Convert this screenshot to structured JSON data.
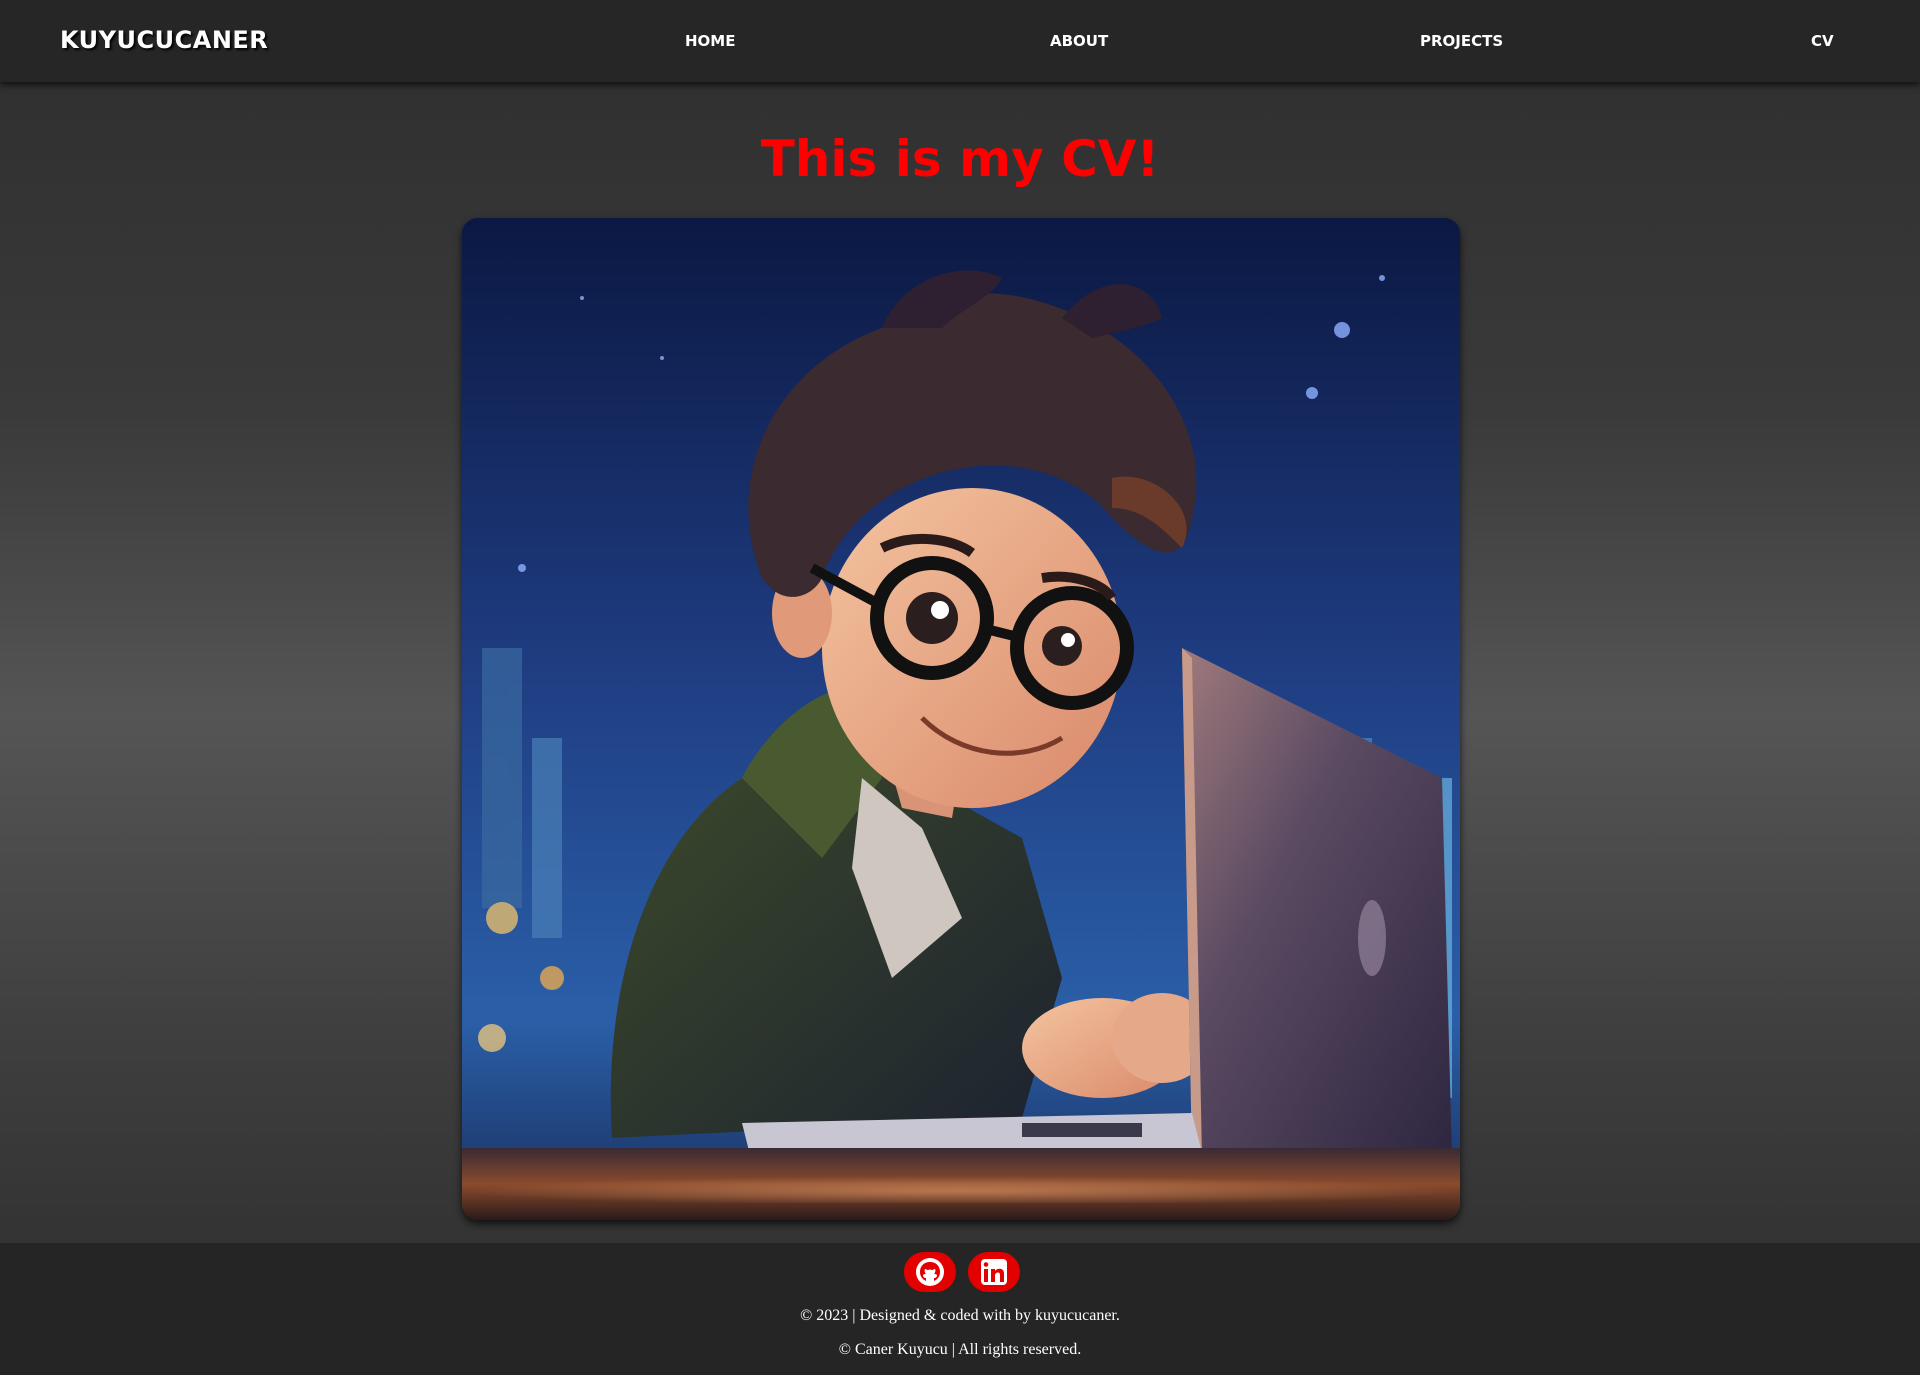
{
  "brand": {
    "name": "KUYUCUCANER"
  },
  "nav": {
    "items": [
      {
        "label": "HOME"
      },
      {
        "label": "ABOUT"
      },
      {
        "label": "PROJECTS"
      },
      {
        "label": "CV"
      }
    ]
  },
  "main": {
    "title": "This is my CV!",
    "image": {
      "icon": "cartoon-boy-with-laptop-illustration"
    }
  },
  "footer": {
    "social": [
      {
        "icon": "github-icon"
      },
      {
        "icon": "linkedin-icon"
      }
    ],
    "line1": "© 2023 | Designed & coded with by kuyucucaner.",
    "line2": "© Caner Kuyucu | All rights reserved."
  },
  "colors": {
    "accent": "#ff0000",
    "navbar": "#262626",
    "footer": "#252525",
    "social_bg": "#e30000"
  }
}
